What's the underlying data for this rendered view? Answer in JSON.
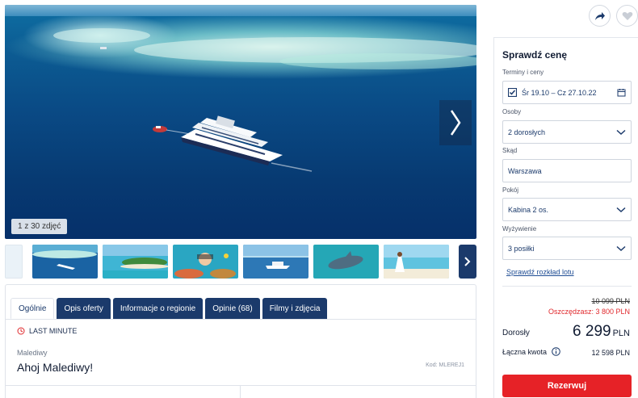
{
  "gallery": {
    "counter": "1 z 30 zdjęć",
    "thumbnails": [
      {
        "name": "thumb-yacht-aerial"
      },
      {
        "name": "thumb-island-beach"
      },
      {
        "name": "thumb-snorkeling"
      },
      {
        "name": "thumb-yacht-side"
      },
      {
        "name": "thumb-dolphin"
      },
      {
        "name": "thumb-woman-beach"
      }
    ]
  },
  "tabs": [
    "Ogólnie",
    "Opis oferty",
    "Informacje o regionie",
    "Opinie (68)",
    "Filmy i zdjęcia"
  ],
  "offer": {
    "badge": "LAST MINUTE",
    "country": "Malediwy",
    "title": "Ahoj Malediwy!",
    "code": "Kod: MLEREJ1"
  },
  "booking": {
    "title": "Sprawdź cenę",
    "dates_label": "Terminy i ceny",
    "dates_value": "Śr 19.10 – Cz 27.10.22",
    "persons_label": "Osoby",
    "persons_value": "2 dorosłych",
    "from_label": "Skąd",
    "from_value": "Warszawa",
    "room_label": "Pokój",
    "room_value": "Kabina 2 os.",
    "board_label": "Wyżywienie",
    "board_value": "3 posiłki",
    "flight_link": "Sprawdź rozkład lotu",
    "old_price": "10 099 PLN",
    "savings": "Oszczędzasz: 3 800 PLN",
    "adults_label": "Dorosły",
    "price_value": "6 299",
    "price_currency": "PLN",
    "total_label": "Łączna kwota",
    "total_value": "12 598 PLN",
    "reserve_label": "Rezerwuj"
  },
  "colors": {
    "navy": "#1b3a6b",
    "accent_red": "#e62227",
    "link_blue": "#1f4d94"
  }
}
